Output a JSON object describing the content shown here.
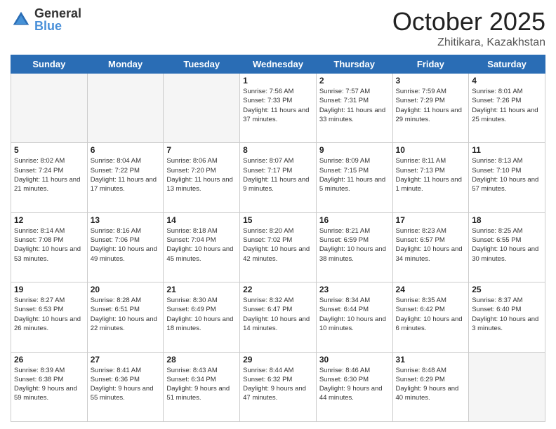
{
  "header": {
    "logo_line1": "General",
    "logo_line2": "Blue",
    "month": "October 2025",
    "location": "Zhitikara, Kazakhstan"
  },
  "days_of_week": [
    "Sunday",
    "Monday",
    "Tuesday",
    "Wednesday",
    "Thursday",
    "Friday",
    "Saturday"
  ],
  "weeks": [
    [
      {
        "day": "",
        "sunrise": "",
        "sunset": "",
        "daylight": ""
      },
      {
        "day": "",
        "sunrise": "",
        "sunset": "",
        "daylight": ""
      },
      {
        "day": "",
        "sunrise": "",
        "sunset": "",
        "daylight": ""
      },
      {
        "day": "1",
        "sunrise": "Sunrise: 7:56 AM",
        "sunset": "Sunset: 7:33 PM",
        "daylight": "Daylight: 11 hours and 37 minutes."
      },
      {
        "day": "2",
        "sunrise": "Sunrise: 7:57 AM",
        "sunset": "Sunset: 7:31 PM",
        "daylight": "Daylight: 11 hours and 33 minutes."
      },
      {
        "day": "3",
        "sunrise": "Sunrise: 7:59 AM",
        "sunset": "Sunset: 7:29 PM",
        "daylight": "Daylight: 11 hours and 29 minutes."
      },
      {
        "day": "4",
        "sunrise": "Sunrise: 8:01 AM",
        "sunset": "Sunset: 7:26 PM",
        "daylight": "Daylight: 11 hours and 25 minutes."
      }
    ],
    [
      {
        "day": "5",
        "sunrise": "Sunrise: 8:02 AM",
        "sunset": "Sunset: 7:24 PM",
        "daylight": "Daylight: 11 hours and 21 minutes."
      },
      {
        "day": "6",
        "sunrise": "Sunrise: 8:04 AM",
        "sunset": "Sunset: 7:22 PM",
        "daylight": "Daylight: 11 hours and 17 minutes."
      },
      {
        "day": "7",
        "sunrise": "Sunrise: 8:06 AM",
        "sunset": "Sunset: 7:20 PM",
        "daylight": "Daylight: 11 hours and 13 minutes."
      },
      {
        "day": "8",
        "sunrise": "Sunrise: 8:07 AM",
        "sunset": "Sunset: 7:17 PM",
        "daylight": "Daylight: 11 hours and 9 minutes."
      },
      {
        "day": "9",
        "sunrise": "Sunrise: 8:09 AM",
        "sunset": "Sunset: 7:15 PM",
        "daylight": "Daylight: 11 hours and 5 minutes."
      },
      {
        "day": "10",
        "sunrise": "Sunrise: 8:11 AM",
        "sunset": "Sunset: 7:13 PM",
        "daylight": "Daylight: 11 hours and 1 minute."
      },
      {
        "day": "11",
        "sunrise": "Sunrise: 8:13 AM",
        "sunset": "Sunset: 7:10 PM",
        "daylight": "Daylight: 10 hours and 57 minutes."
      }
    ],
    [
      {
        "day": "12",
        "sunrise": "Sunrise: 8:14 AM",
        "sunset": "Sunset: 7:08 PM",
        "daylight": "Daylight: 10 hours and 53 minutes."
      },
      {
        "day": "13",
        "sunrise": "Sunrise: 8:16 AM",
        "sunset": "Sunset: 7:06 PM",
        "daylight": "Daylight: 10 hours and 49 minutes."
      },
      {
        "day": "14",
        "sunrise": "Sunrise: 8:18 AM",
        "sunset": "Sunset: 7:04 PM",
        "daylight": "Daylight: 10 hours and 45 minutes."
      },
      {
        "day": "15",
        "sunrise": "Sunrise: 8:20 AM",
        "sunset": "Sunset: 7:02 PM",
        "daylight": "Daylight: 10 hours and 42 minutes."
      },
      {
        "day": "16",
        "sunrise": "Sunrise: 8:21 AM",
        "sunset": "Sunset: 6:59 PM",
        "daylight": "Daylight: 10 hours and 38 minutes."
      },
      {
        "day": "17",
        "sunrise": "Sunrise: 8:23 AM",
        "sunset": "Sunset: 6:57 PM",
        "daylight": "Daylight: 10 hours and 34 minutes."
      },
      {
        "day": "18",
        "sunrise": "Sunrise: 8:25 AM",
        "sunset": "Sunset: 6:55 PM",
        "daylight": "Daylight: 10 hours and 30 minutes."
      }
    ],
    [
      {
        "day": "19",
        "sunrise": "Sunrise: 8:27 AM",
        "sunset": "Sunset: 6:53 PM",
        "daylight": "Daylight: 10 hours and 26 minutes."
      },
      {
        "day": "20",
        "sunrise": "Sunrise: 8:28 AM",
        "sunset": "Sunset: 6:51 PM",
        "daylight": "Daylight: 10 hours and 22 minutes."
      },
      {
        "day": "21",
        "sunrise": "Sunrise: 8:30 AM",
        "sunset": "Sunset: 6:49 PM",
        "daylight": "Daylight: 10 hours and 18 minutes."
      },
      {
        "day": "22",
        "sunrise": "Sunrise: 8:32 AM",
        "sunset": "Sunset: 6:47 PM",
        "daylight": "Daylight: 10 hours and 14 minutes."
      },
      {
        "day": "23",
        "sunrise": "Sunrise: 8:34 AM",
        "sunset": "Sunset: 6:44 PM",
        "daylight": "Daylight: 10 hours and 10 minutes."
      },
      {
        "day": "24",
        "sunrise": "Sunrise: 8:35 AM",
        "sunset": "Sunset: 6:42 PM",
        "daylight": "Daylight: 10 hours and 6 minutes."
      },
      {
        "day": "25",
        "sunrise": "Sunrise: 8:37 AM",
        "sunset": "Sunset: 6:40 PM",
        "daylight": "Daylight: 10 hours and 3 minutes."
      }
    ],
    [
      {
        "day": "26",
        "sunrise": "Sunrise: 8:39 AM",
        "sunset": "Sunset: 6:38 PM",
        "daylight": "Daylight: 9 hours and 59 minutes."
      },
      {
        "day": "27",
        "sunrise": "Sunrise: 8:41 AM",
        "sunset": "Sunset: 6:36 PM",
        "daylight": "Daylight: 9 hours and 55 minutes."
      },
      {
        "day": "28",
        "sunrise": "Sunrise: 8:43 AM",
        "sunset": "Sunset: 6:34 PM",
        "daylight": "Daylight: 9 hours and 51 minutes."
      },
      {
        "day": "29",
        "sunrise": "Sunrise: 8:44 AM",
        "sunset": "Sunset: 6:32 PM",
        "daylight": "Daylight: 9 hours and 47 minutes."
      },
      {
        "day": "30",
        "sunrise": "Sunrise: 8:46 AM",
        "sunset": "Sunset: 6:30 PM",
        "daylight": "Daylight: 9 hours and 44 minutes."
      },
      {
        "day": "31",
        "sunrise": "Sunrise: 8:48 AM",
        "sunset": "Sunset: 6:29 PM",
        "daylight": "Daylight: 9 hours and 40 minutes."
      },
      {
        "day": "",
        "sunrise": "",
        "sunset": "",
        "daylight": ""
      }
    ]
  ]
}
